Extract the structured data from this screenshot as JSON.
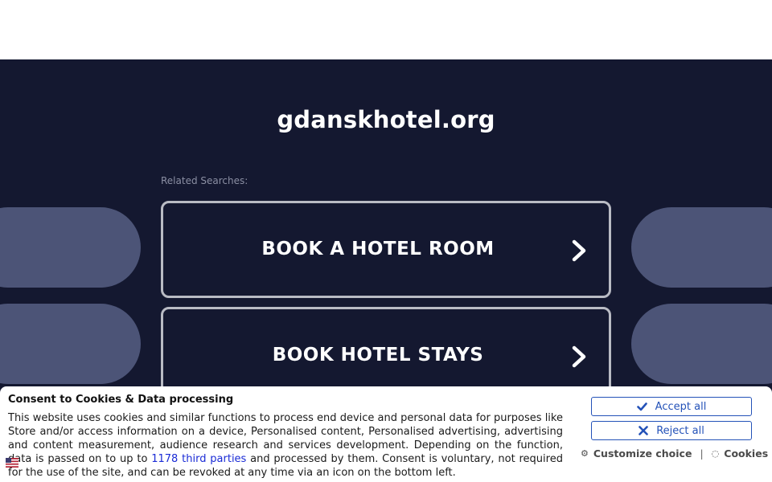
{
  "page": {
    "domain": "gdanskhotel.org",
    "related_label": "Related Searches:"
  },
  "searches": [
    {
      "label": "BOOK A HOTEL ROOM"
    },
    {
      "label": "BOOK HOTEL STAYS"
    }
  ],
  "cookie": {
    "title": "Consent to Cookies & Data processing",
    "text_before": "This website uses cookies and similar functions to process end device and personal data for purposes like Store and/or access information on a device, Personalised content, Personalised advertising, advertising and content measurement, audience research and services development. Depending on the function, data is passed on to up to ",
    "link_text": "1178 third parties",
    "text_after": " and processed by them. Consent is voluntary, not required for the use of the site, and can be revoked at any time via an icon on the bottom left.",
    "accept_label": "Accept all",
    "reject_label": "Reject all",
    "customize_label": "Customize choice",
    "separator": "|",
    "cookies_label": "Cookies"
  },
  "colors": {
    "background": "#141830",
    "pill": "#4c5477",
    "button_border": "#b9bbc4",
    "consent_accent": "#2452b8"
  },
  "icons": [
    "chevron-right-icon",
    "check-icon",
    "x-icon",
    "gear-icon",
    "cookie-icon",
    "flag-icon"
  ]
}
